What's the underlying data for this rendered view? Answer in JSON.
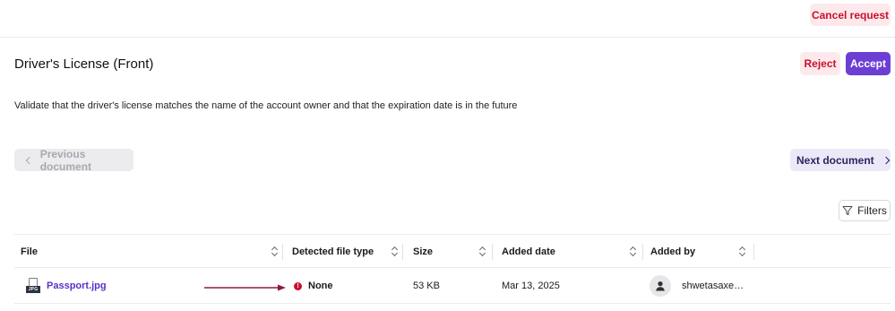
{
  "header": {
    "cancel_label": "Cancel request"
  },
  "document": {
    "title": "Driver's License (Front)",
    "reject_label": "Reject",
    "accept_label": "Accept",
    "description": "Validate that the driver's license matches the name of the account owner and that the expiration date is in the future"
  },
  "navigation": {
    "prev_label": "Previous document",
    "next_label": "Next document"
  },
  "filters": {
    "label": "Filters",
    "icon": "filter-icon"
  },
  "table": {
    "columns": [
      "File",
      "Detected file type",
      "Size",
      "Added date",
      "Added by"
    ],
    "rows": [
      {
        "file_name": "Passport.jpg",
        "file_tag": "JPG",
        "detected_type": "None",
        "size": "53 KB",
        "added_date": "Mar 13, 2025",
        "added_by": "shwetasaxe…"
      }
    ]
  },
  "colors": {
    "accent": "#6b3fd4",
    "danger": "#c8102e",
    "danger_bg": "#fde9ec",
    "arrow": "#8b1a4a"
  }
}
